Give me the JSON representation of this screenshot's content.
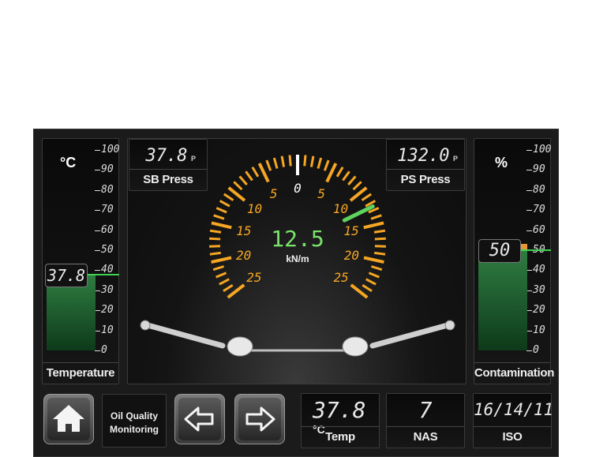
{
  "temperature": {
    "unit": "°C",
    "value_display": "37.8",
    "value": 37.8,
    "label": "Temperature",
    "scale": [
      "100",
      "90",
      "80",
      "70",
      "60",
      "50",
      "40",
      "30",
      "20",
      "10",
      "0"
    ]
  },
  "contamination": {
    "unit": "%",
    "value_display": "50",
    "value": 50,
    "label": "Contamination",
    "scale": [
      "100",
      "90",
      "80",
      "70",
      "60",
      "50",
      "40",
      "30",
      "20",
      "10",
      "0"
    ]
  },
  "sb_press": {
    "value": "37.8",
    "unit": "P",
    "label": "SB Press"
  },
  "ps_press": {
    "value": "132.0",
    "unit": "P",
    "label": "PS Press"
  },
  "gauge": {
    "value": "12.5",
    "unit": "kN/m",
    "needle_value": 12.5,
    "left_scale": [
      "5",
      "10",
      "15",
      "20",
      "25"
    ],
    "right_scale": [
      "5",
      "10",
      "15",
      "20",
      "25"
    ],
    "center_label": "0",
    "accent_color": "#f5a623",
    "needle_color": "#5fd25f"
  },
  "bottom": {
    "home_label": "home",
    "title_line1": "Oil Quality",
    "title_line2": "Monitoring",
    "temp": {
      "value": "37.8",
      "unit": "°C",
      "label": "Temp"
    },
    "nas": {
      "value": "7",
      "label": "NAS"
    },
    "iso": {
      "value": "16/14/11",
      "label": "ISO"
    }
  }
}
